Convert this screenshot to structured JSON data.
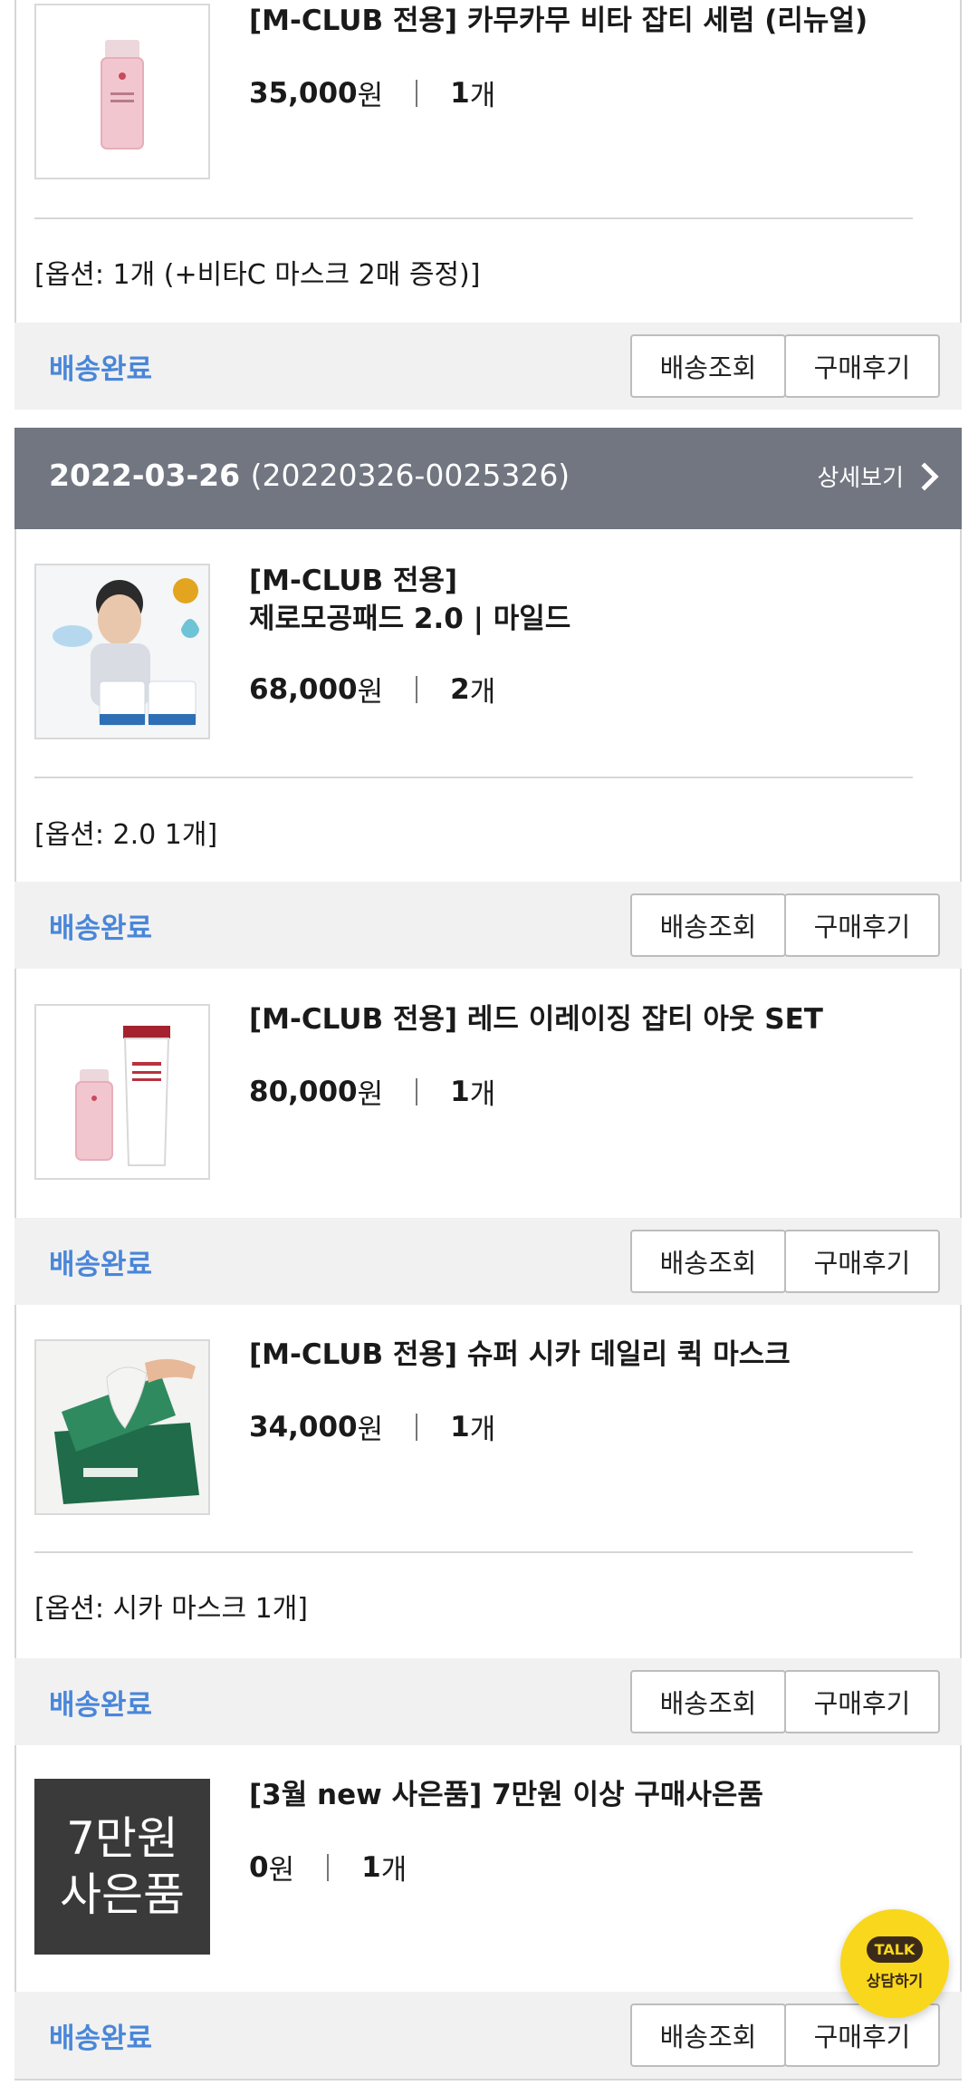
{
  "orders": [
    {
      "items": [
        {
          "title_lines": [
            "[M-CLUB 전용] 카무카무 비타 잡티 세럼 (리뉴얼)"
          ],
          "price": "35,000",
          "price_unit": "원",
          "qty": "1",
          "qty_unit": "개",
          "option": "[옵션: 1개 (+비타C 마스크 2매 증정)]",
          "status": "배송완료",
          "track_label": "배송조회",
          "review_label": "구매후기"
        }
      ]
    },
    {
      "date": "2022-03-26",
      "order_number": "(20220326-0025326)",
      "detail_label": "상세보기",
      "items": [
        {
          "title_lines": [
            "[M-CLUB 전용]",
            "제로모공패드 2.0 | 마일드"
          ],
          "price": "68,000",
          "price_unit": "원",
          "qty": "2",
          "qty_unit": "개",
          "option": "[옵션: 2.0 1개]",
          "status": "배송완료",
          "track_label": "배송조회",
          "review_label": "구매후기"
        },
        {
          "title_lines": [
            "[M-CLUB 전용] 레드 이레이징 잡티 아웃 SET"
          ],
          "price": "80,000",
          "price_unit": "원",
          "qty": "1",
          "qty_unit": "개",
          "status": "배송완료",
          "track_label": "배송조회",
          "review_label": "구매후기"
        },
        {
          "title_lines": [
            "[M-CLUB 전용] 슈퍼 시카 데일리 퀵 마스크"
          ],
          "price": "34,000",
          "price_unit": "원",
          "qty": "1",
          "qty_unit": "개",
          "option": "[옵션: 시카 마스크 1개]",
          "status": "배송완료",
          "track_label": "배송조회",
          "review_label": "구매후기"
        },
        {
          "title_lines": [
            "[3월 new 사은품] 7만원 이상 구매사은품"
          ],
          "thumb_text": [
            "7만원",
            "사은품"
          ],
          "price": "0",
          "price_unit": "원",
          "qty": "1",
          "qty_unit": "개",
          "status": "배송완료",
          "track_label": "배송조회",
          "review_label": "구매후기"
        }
      ]
    }
  ],
  "chat_button": {
    "bubble": "TALK",
    "label": "상담하기"
  },
  "colors": {
    "status": "#4a86d8",
    "header_bg": "#717681",
    "talk_bg": "#f9d71c"
  }
}
